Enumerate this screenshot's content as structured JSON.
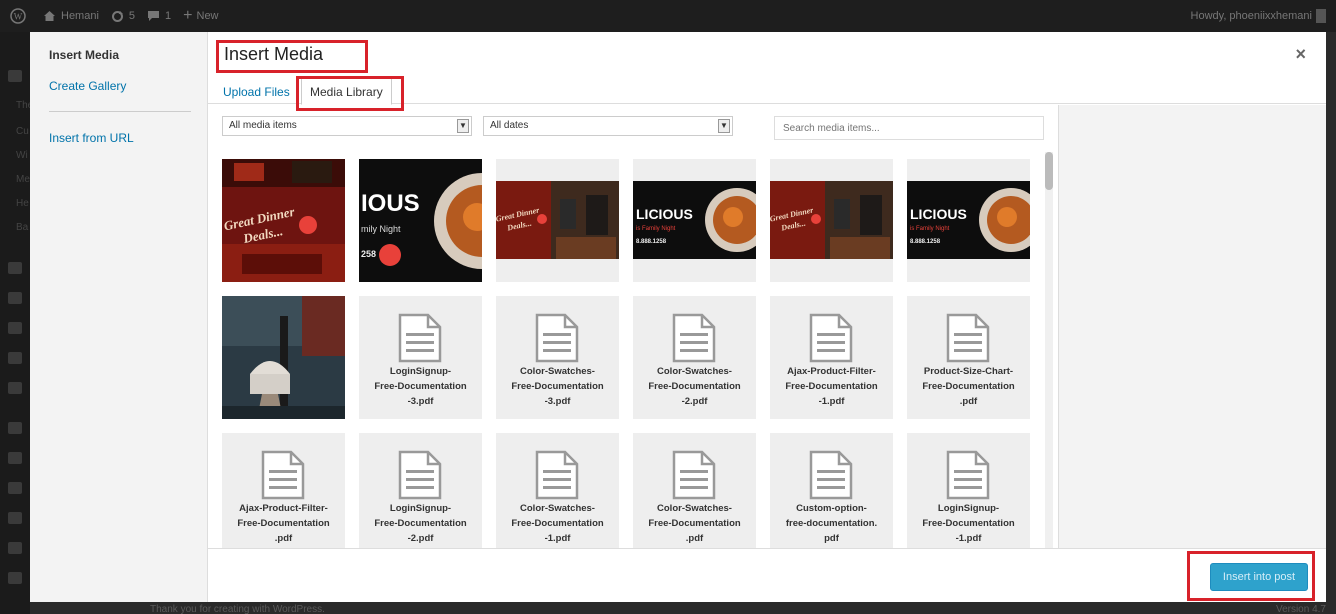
{
  "admin_bar": {
    "site_name": "Hemani",
    "updates_count": "5",
    "comments_count": "1",
    "new_label": "New",
    "howdy": "Howdy, phoeniixxhemani"
  },
  "admin_menu_fragments": [
    "The",
    "Cu",
    "Wi",
    "Me",
    "He",
    "Ba"
  ],
  "footer": {
    "thanks": "Thank you for creating with WordPress.",
    "version": "Version 4.7"
  },
  "modal": {
    "sidebar": {
      "title": "Insert Media",
      "create_gallery": "Create Gallery",
      "insert_from_url": "Insert from URL"
    },
    "title": "Insert Media",
    "close": "×",
    "tabs": [
      "Upload Files",
      "Media Library"
    ],
    "active_tab": "Media Library",
    "toolbar": {
      "type_filter": "All media items",
      "date_filter": "All dates",
      "search_placeholder": "Search media items..."
    },
    "items": [
      {
        "kind": "image",
        "variant": "dinner"
      },
      {
        "kind": "image",
        "variant": "licious-large"
      },
      {
        "kind": "image",
        "variant": "dinner-small"
      },
      {
        "kind": "image",
        "variant": "licious"
      },
      {
        "kind": "image",
        "variant": "dinner-small"
      },
      {
        "kind": "image",
        "variant": "licious"
      },
      {
        "kind": "image",
        "variant": "coffee"
      },
      {
        "kind": "file",
        "lines": [
          "LoginSignup-",
          "Free-Documentation",
          "-3.pdf"
        ]
      },
      {
        "kind": "file",
        "lines": [
          "Color-Swatches-",
          "Free-Documentation",
          "-3.pdf"
        ]
      },
      {
        "kind": "file",
        "lines": [
          "Color-Swatches-",
          "Free-Documentation",
          "-2.pdf"
        ]
      },
      {
        "kind": "file",
        "lines": [
          "Ajax-Product-Filter-",
          "Free-Documentation",
          "-1.pdf"
        ]
      },
      {
        "kind": "file",
        "lines": [
          "Product-Size-Chart-",
          "Free-Documentation",
          ".pdf"
        ]
      },
      {
        "kind": "file",
        "lines": [
          "Ajax-Product-Filter-",
          "Free-Documentation",
          ".pdf"
        ]
      },
      {
        "kind": "file",
        "lines": [
          "LoginSignup-",
          "Free-Documentation",
          "-2.pdf"
        ]
      },
      {
        "kind": "file",
        "lines": [
          "Color-Swatches-",
          "Free-Documentation",
          "-1.pdf"
        ]
      },
      {
        "kind": "file",
        "lines": [
          "Color-Swatches-",
          "Free-Documentation",
          ".pdf"
        ]
      },
      {
        "kind": "file",
        "lines": [
          "Custom-option-",
          "free-documentation.",
          "pdf"
        ]
      },
      {
        "kind": "file",
        "lines": [
          "LoginSignup-",
          "Free-Documentation",
          "-1.pdf"
        ]
      }
    ],
    "image_text": {
      "dinner_1": "Great Dinner",
      "dinner_2": "Deals...",
      "licious_big": "IOUS",
      "licious_small": "LICIOUS",
      "family_night": "mily Night",
      "family_night_small": "is Family Night",
      "phone": "258",
      "phone_small": "8.888.1258"
    },
    "insert_button": "Insert into post"
  },
  "colors": {
    "highlight": "#d8222a",
    "link": "#0073aa",
    "primary_button": "#2ea2cc"
  }
}
